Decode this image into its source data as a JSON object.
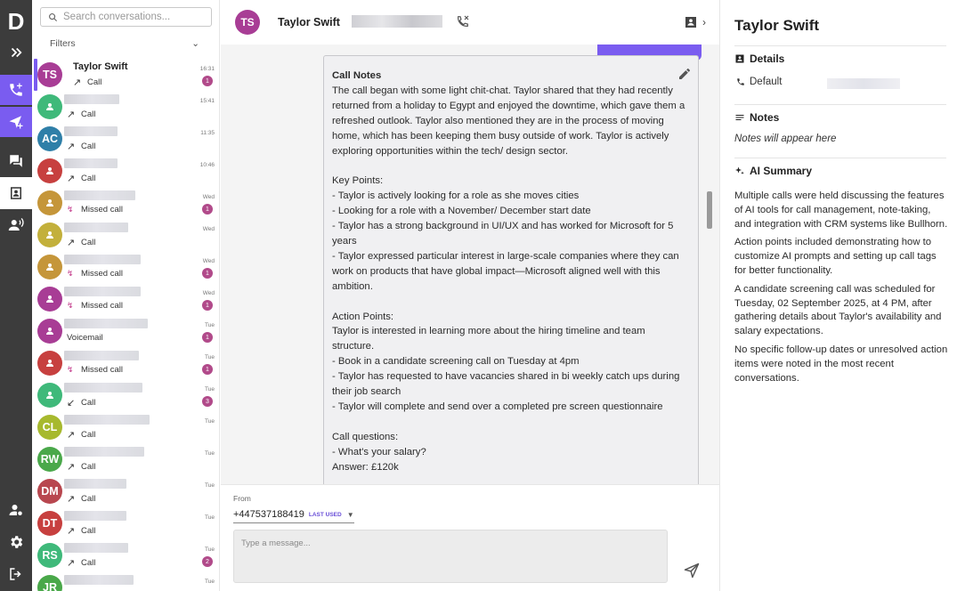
{
  "nav": {
    "logo": "D",
    "items": [
      {
        "name": "expand-nav-button",
        "icon": "double-chevron-right-icon"
      },
      {
        "name": "calls-button",
        "icon": "phone-plus-icon"
      },
      {
        "name": "send-campaign-button",
        "icon": "send-plus-icon"
      },
      {
        "name": "conversations-button",
        "icon": "chat-icon"
      },
      {
        "name": "contacts-button",
        "icon": "contact-card-icon"
      },
      {
        "name": "voice-button",
        "icon": "speaking-person-icon"
      },
      {
        "name": "account-button",
        "icon": "person-settings-icon"
      },
      {
        "name": "settings-button",
        "icon": "gear-icon"
      },
      {
        "name": "logout-button",
        "icon": "logout-icon"
      }
    ]
  },
  "sidebar": {
    "search_placeholder": "Search conversations...",
    "filters_label": "Filters",
    "conversations": [
      {
        "initials": "TS",
        "color": "#a83d95",
        "name": "Taylor Swift",
        "sub": "Call",
        "kind": "outgoing",
        "time": "16:31",
        "badge": "1",
        "selected": true
      },
      {
        "initials": "",
        "color": "#3fb97a",
        "name": "",
        "sub": "Call",
        "kind": "outgoing",
        "time": "15:41",
        "badge": ""
      },
      {
        "initials": "AC",
        "color": "#2f7fa8",
        "name": "",
        "sub": "Call",
        "kind": "outgoing",
        "time": "11:35",
        "badge": ""
      },
      {
        "initials": "",
        "color": "#c7403f",
        "name": "",
        "sub": "Call",
        "kind": "outgoing",
        "time": "10:46",
        "badge": ""
      },
      {
        "initials": "",
        "color": "#c5963a",
        "name": "",
        "sub": "Missed call",
        "kind": "missed",
        "time": "Wed",
        "badge": "1"
      },
      {
        "initials": "",
        "color": "#c3b03b",
        "name": "",
        "sub": "Call",
        "kind": "outgoing",
        "time": "Wed",
        "badge": ""
      },
      {
        "initials": "",
        "color": "#c5963a",
        "name": "",
        "sub": "Missed call",
        "kind": "missed",
        "time": "Wed",
        "badge": "1"
      },
      {
        "initials": "",
        "color": "#a83d95",
        "name": "",
        "sub": "Missed call",
        "kind": "missed",
        "time": "Wed",
        "badge": "1"
      },
      {
        "initials": "",
        "color": "#a83d95",
        "name": "",
        "sub": "Voicemail",
        "kind": "none",
        "time": "Tue",
        "badge": "1"
      },
      {
        "initials": "",
        "color": "#c7403f",
        "name": "",
        "sub": "Missed call",
        "kind": "missed",
        "time": "Tue",
        "badge": "1"
      },
      {
        "initials": "",
        "color": "#3fb97a",
        "name": "",
        "sub": "Call",
        "kind": "incoming",
        "time": "Tue",
        "badge": "3"
      },
      {
        "initials": "CL",
        "color": "#a7b92e",
        "name": "",
        "sub": "Call",
        "kind": "outgoing",
        "time": "Tue",
        "badge": ""
      },
      {
        "initials": "RW",
        "color": "#4aa84a",
        "name": "",
        "sub": "Call",
        "kind": "outgoing",
        "time": "Tue",
        "badge": ""
      },
      {
        "initials": "DM",
        "color": "#b8474f",
        "name": "",
        "sub": "Call",
        "kind": "outgoing",
        "time": "Tue",
        "badge": ""
      },
      {
        "initials": "DT",
        "color": "#c7403f",
        "name": "",
        "sub": "Call",
        "kind": "outgoing",
        "time": "Tue",
        "badge": ""
      },
      {
        "initials": "RS",
        "color": "#3fb97a",
        "name": "",
        "sub": "Call",
        "kind": "outgoing",
        "time": "Tue",
        "badge": "2"
      },
      {
        "initials": "JR",
        "color": "#4aa84a",
        "name": "",
        "sub": "",
        "kind": "none",
        "time": "Tue",
        "badge": ""
      }
    ]
  },
  "header": {
    "initials": "TS",
    "name": "Taylor Swift"
  },
  "call_notes": {
    "title": "Call Notes",
    "body": "The call began with some light chit-chat. Taylor shared that they had recently returned from a holiday to Egypt and enjoyed the downtime, which gave them a refreshed outlook. Taylor also mentioned they are in the process of moving home, which has been keeping them busy outside of work. Taylor is actively exploring opportunities within the tech/ design sector.\n\nKey Points:\n- Taylor is actively looking for a role as she moves cities\n- Looking for a role with a November/ December start date\n- Taylor has a strong background in UI/UX and has worked for Microsoft for 5 years\n- Taylor expressed particular interest in large-scale companies where they can work on products that have global impact—Microsoft aligned well with this ambition.\n\nAction Points:\nTaylor is interested in learning more about the hiring timeline and team structure.\n- Book in a candidate screening call on Tuesday at 4pm\n- Taylor has requested to have vacancies shared in bi weekly catch ups during their job search\n- Taylor will complete and send over a completed pre screen questionnaire\n\nCall questions:\n- What's your salary?\nAnswer: £120k"
  },
  "composer": {
    "from_label": "From",
    "from_number": "+447537188419",
    "last_used": "LAST USED",
    "placeholder": "Type a message..."
  },
  "details": {
    "title": "Taylor Swift",
    "details_heading": "Details",
    "phone_label": "Default",
    "notes_heading": "Notes",
    "notes_placeholder": "Notes will appear here",
    "ai_heading": "AI Summary",
    "ai_paragraphs": [
      "Multiple calls were held discussing the features of AI tools for call management, note-taking, and integration with CRM systems like Bullhorn.",
      "Action points included demonstrating how to customize AI prompts and setting up call tags for better functionality.",
      "A candidate screening call was scheduled for Tuesday, 02 September 2025, at 4 PM, after gathering details about Taylor's availability and salary expectations.",
      "No specific follow-up dates or unresolved action items were noted in the most recent conversations."
    ]
  },
  "colors": {
    "accent": "#7a5cf0",
    "rail": "#3c3c3c",
    "badge": "#b14a8a"
  }
}
